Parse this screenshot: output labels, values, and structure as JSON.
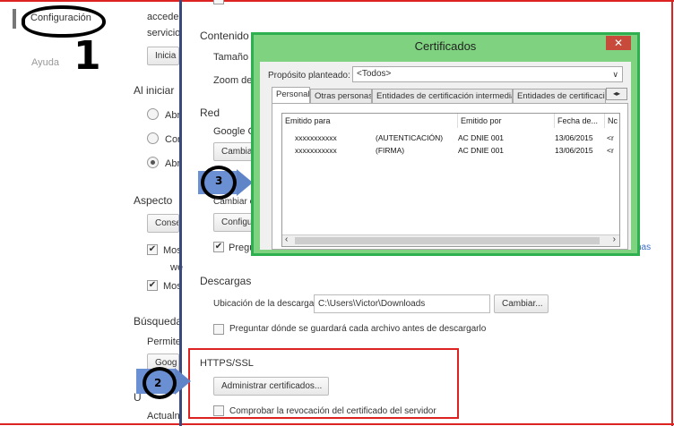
{
  "left_nav": {
    "config": "Configuración",
    "help": "Ayuda"
  },
  "annotations": {
    "one": "1",
    "two": "2",
    "three": "3"
  },
  "left_clipped": {
    "line1": "acceder",
    "line2": "servicio",
    "iniciar_btn": "Inicia",
    "al_iniciar": "Al iniciar",
    "radio1": "Abr",
    "radio2": "Cor",
    "radio3": "Abr",
    "aspecto": "Aspecto",
    "conse_btn": "Conse",
    "mos1": "Mos",
    "we": "we",
    "mos2": "Mos",
    "busqueda": "Búsqueda",
    "permite": "Permite",
    "goog_btn": "Goog",
    "u_letter": "U",
    "actual": "Actualn"
  },
  "settings": {
    "contenido": "Contenido",
    "tamano": "Tamaño d",
    "zoom": "Zoom de",
    "red": "Red",
    "google_c": "Google Cl",
    "cambia_btn": "Cambia",
    "cambiar_c": "Cambiar c",
    "configu_btn": "Configu",
    "pregun": "Pregun",
    "has": "has",
    "descargas": "Descargas",
    "ubicacion_label": "Ubicación de la descarga:",
    "ubicacion_value": "C:\\Users\\Victor\\Downloads",
    "cambiar_btn": "Cambiar...",
    "preguntar_cb": "Preguntar dónde se guardará cada archivo antes de descargarlo",
    "https_title": "HTTPS/SSL",
    "admin_cert_btn": "Administrar certificados...",
    "comprobar_cb": "Comprobar la revocación del certificado del servidor"
  },
  "dialog": {
    "title": "Certificados",
    "close": "✕",
    "proposito_label": "Propósito planteado:",
    "proposito_value": "<Todos>",
    "tabs": [
      "Personal",
      "Otras personas",
      "Entidades de certificación intermedias",
      "Entidades de certificaci"
    ],
    "columns": [
      "Emitido para",
      "Emitido por",
      "Fecha de...",
      "Nc"
    ],
    "rows": [
      {
        "para": "xxxxxxxxxxx",
        "type": "(AUTENTICACIÓN)",
        "por": "AC DNIE 001",
        "fecha": "13/06/2015",
        "extra": "<r"
      },
      {
        "para": "xxxxxxxxxxx",
        "type": "(FIRMA)",
        "por": "AC DNIE 001",
        "fecha": "13/06/2015",
        "extra": "<r"
      }
    ]
  }
}
